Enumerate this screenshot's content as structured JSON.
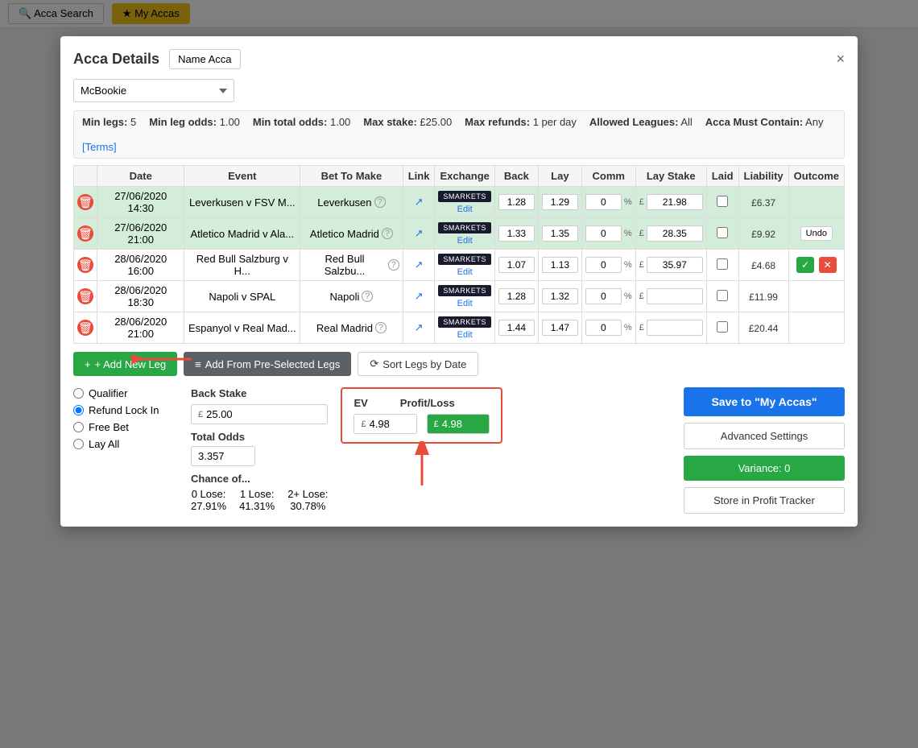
{
  "topbar": {
    "acca_search": "Acca Search",
    "my_accas": "My Accas"
  },
  "modal": {
    "title": "Acca Details",
    "name_acca_btn": "Name Acca",
    "close_icon": "×",
    "bookmaker": "McBookie",
    "info": {
      "min_legs_label": "Min legs:",
      "min_legs": "5",
      "min_leg_odds_label": "Min leg odds:",
      "min_leg_odds": "1.00",
      "min_total_odds_label": "Min total odds:",
      "min_total_odds": "1.00",
      "max_stake_label": "Max stake:",
      "max_stake": "£25.00",
      "max_refunds_label": "Max refunds:",
      "max_refunds": "1 per day",
      "allowed_leagues_label": "Allowed Leagues:",
      "allowed_leagues": "All",
      "acca_must_contain_label": "Acca Must Contain:",
      "acca_must_contain": "Any",
      "terms": "[Terms]"
    },
    "table": {
      "headers": [
        "Date",
        "Event",
        "Bet To Make",
        "Link",
        "Exchange",
        "Back",
        "Lay",
        "Comm",
        "Lay Stake",
        "Laid",
        "Liability",
        "Outcome"
      ],
      "rows": [
        {
          "id": 1,
          "date": "27/06/2020 14:30",
          "event": "Leverkusen v FSV M...",
          "bet_to_make": "Leverkusen",
          "exchange": "SMARKETS",
          "back": "1.28",
          "lay": "1.29",
          "comm": "0",
          "lay_stake": "21.98",
          "laid": false,
          "liability": "£6.37",
          "outcome": "",
          "row_class": "row-green"
        },
        {
          "id": 2,
          "date": "27/06/2020 21:00",
          "event": "Atletico Madrid v Ala...",
          "bet_to_make": "Atletico Madrid",
          "exchange": "SMARKETS",
          "back": "1.33",
          "lay": "1.35",
          "comm": "0",
          "lay_stake": "28.35",
          "laid": false,
          "liability": "£9.92",
          "outcome": "Undo",
          "row_class": "row-green"
        },
        {
          "id": 3,
          "date": "28/06/2020 16:00",
          "event": "Red Bull Salzburg v H...",
          "bet_to_make": "Red Bull Salzbu...",
          "exchange": "SMARKETS",
          "back": "1.07",
          "lay": "1.13",
          "comm": "0",
          "lay_stake": "35.97",
          "laid": false,
          "liability": "£4.68",
          "outcome": "confirm_cancel",
          "row_class": "row-white"
        },
        {
          "id": 4,
          "date": "28/06/2020 18:30",
          "event": "Napoli v SPAL",
          "bet_to_make": "Napoli",
          "exchange": "SMARKETS",
          "back": "1.28",
          "lay": "1.32",
          "comm": "0",
          "lay_stake": "",
          "laid": false,
          "liability": "£11.99",
          "outcome": "",
          "row_class": "row-white"
        },
        {
          "id": 5,
          "date": "28/06/2020 21:00",
          "event": "Espanyol v Real Mad...",
          "bet_to_make": "Real Madrid",
          "exchange": "SMARKETS",
          "back": "1.44",
          "lay": "1.47",
          "comm": "0",
          "lay_stake": "",
          "laid": false,
          "liability": "£20.44",
          "outcome": "",
          "row_class": "row-white"
        }
      ]
    },
    "actions": {
      "add_new_leg": "+ Add New Leg",
      "add_from_preselected": "Add From Pre-Selected Legs",
      "sort_legs": "Sort Legs by Date"
    },
    "bet_type": {
      "qualifier": "Qualifier",
      "refund_lock_in": "Refund Lock In",
      "free_bet": "Free Bet",
      "lay_all": "Lay All",
      "selected": "refund_lock_in"
    },
    "stake": {
      "label": "Back Stake",
      "currency": "£",
      "value": "25.00"
    },
    "total_odds": {
      "label": "Total Odds",
      "value": "3.357"
    },
    "chance": {
      "label": "Chance of...",
      "items": [
        {
          "label": "0 Lose:",
          "value": "27.91%"
        },
        {
          "label": "1 Lose:",
          "value": "41.31%"
        },
        {
          "label": "2+ Lose:",
          "value": "30.78%"
        }
      ]
    },
    "ev": {
      "label": "EV",
      "currency": "£",
      "value": "4.98"
    },
    "profit_loss": {
      "label": "Profit/Loss",
      "currency": "£",
      "value": "4.98"
    },
    "buttons": {
      "save_accas": "Save to \"My Accas\"",
      "advanced_settings": "Advanced Settings",
      "variance": "Variance: 0",
      "store_tracker": "Store in Profit Tracker"
    }
  }
}
